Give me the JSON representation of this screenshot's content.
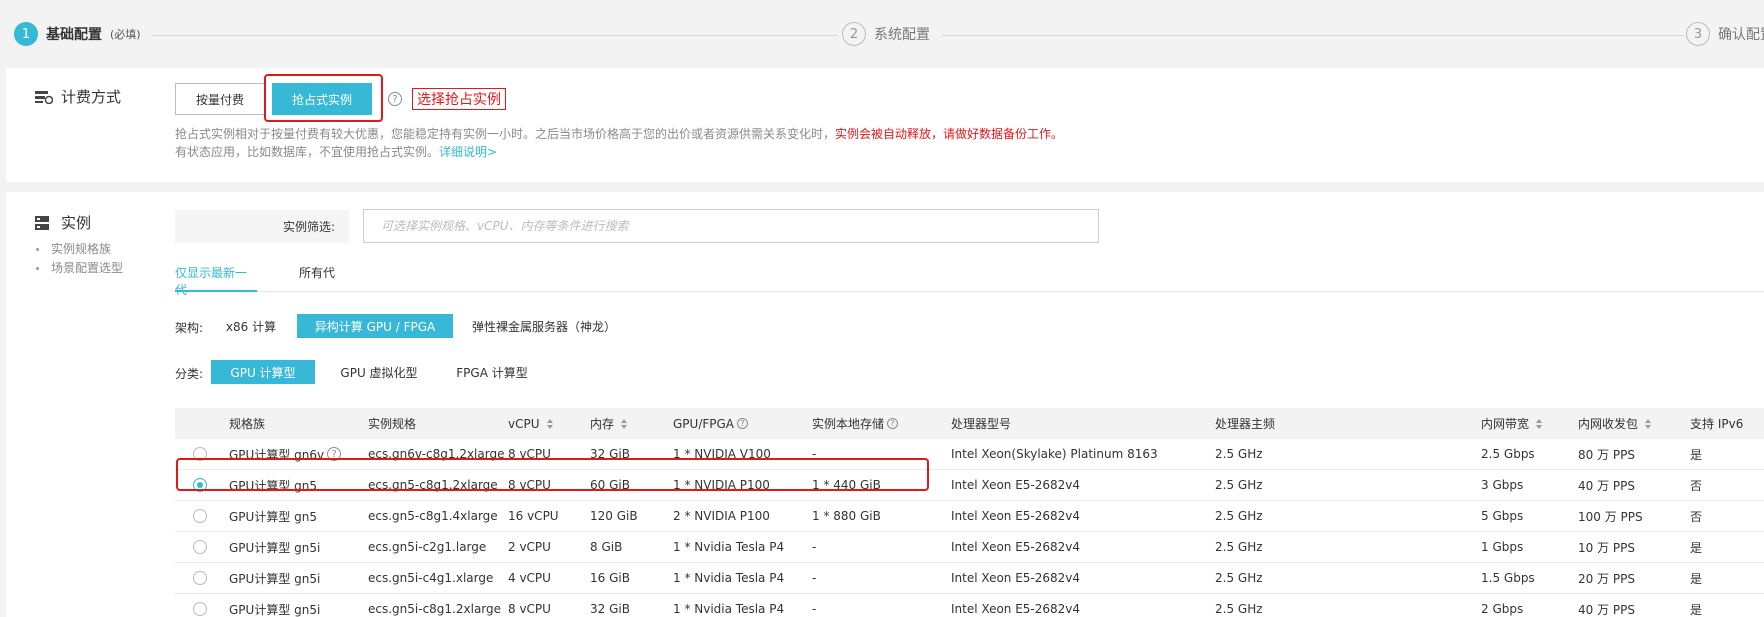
{
  "steps": [
    {
      "num": "1",
      "label": "基础配置",
      "sub": "(必填)"
    },
    {
      "num": "2",
      "label": "系统配置"
    },
    {
      "num": "3",
      "label": "确认配置"
    }
  ],
  "billing": {
    "title": "计费方式",
    "pay_as_you_go": "按量付费",
    "spot": "抢占式实例",
    "help": "?",
    "annotation": "选择抢占实例",
    "desc_line1": "抢占式实例相对于按量付费有较大优惠，您能稳定持有实例一小时。之后当市场价格高于您的出价或者资源供需关系变化时，",
    "desc_warn": "实例会被自动释放，请做好数据备份工作。",
    "desc_line2": "有状态应用，比如数据库，不宜使用抢占式实例。",
    "desc_link": "详细说明>"
  },
  "instance": {
    "title": "实例",
    "side_links": [
      "实例规格族",
      "场景配置选型"
    ],
    "filter_label": "实例筛选:",
    "filter_placeholder": "可选择实例规格、vCPU、内存等条件进行搜索",
    "tabs": [
      "仅显示最新一代",
      "所有代"
    ],
    "arch_label": "架构:",
    "arch_options": [
      "x86 计算",
      "异构计算 GPU / FPGA",
      "弹性裸金属服务器（神龙）"
    ],
    "cat_label": "分类:",
    "cat_options": [
      "GPU 计算型",
      "GPU 虚拟化型",
      "FPGA 计算型"
    ]
  },
  "table": {
    "headers": [
      "规格族",
      "实例规格",
      "vCPU",
      "内存",
      "GPU/FPGA",
      "实例本地存储",
      "处理器型号",
      "处理器主频",
      "内网带宽",
      "内网收发包",
      "支持 IPv6"
    ],
    "rows": [
      {
        "family": "GPU计算型 gn6v",
        "spec": "ecs.gn6v-c8g1.2xlarge",
        "vcpu": "8 vCPU",
        "mem": "32 GiB",
        "gpu": "1 * NVIDIA V100",
        "storage": "-",
        "cpu": "Intel Xeon(Skylake) Platinum 8163",
        "freq": "2.5 GHz",
        "bw": "2.5 Gbps",
        "pps": "80 万 PPS",
        "ipv6": "是"
      },
      {
        "family": "GPU计算型 gn5",
        "spec": "ecs.gn5-c8g1.2xlarge",
        "vcpu": "8 vCPU",
        "mem": "60 GiB",
        "gpu": "1 * NVIDIA P100",
        "storage": "1 * 440 GiB",
        "cpu": "Intel Xeon E5-2682v4",
        "freq": "2.5 GHz",
        "bw": "3 Gbps",
        "pps": "40 万 PPS",
        "ipv6": "否"
      },
      {
        "family": "GPU计算型 gn5",
        "spec": "ecs.gn5-c8g1.4xlarge",
        "vcpu": "16 vCPU",
        "mem": "120 GiB",
        "gpu": "2 * NVIDIA P100",
        "storage": "1 * 880 GiB",
        "cpu": "Intel Xeon E5-2682v4",
        "freq": "2.5 GHz",
        "bw": "5 Gbps",
        "pps": "100 万 PPS",
        "ipv6": "否"
      },
      {
        "family": "GPU计算型 gn5i",
        "spec": "ecs.gn5i-c2g1.large",
        "vcpu": "2 vCPU",
        "mem": "8 GiB",
        "gpu": "1 * Nvidia Tesla P4",
        "storage": "-",
        "cpu": "Intel Xeon E5-2682v4",
        "freq": "2.5 GHz",
        "bw": "1 Gbps",
        "pps": "10 万 PPS",
        "ipv6": "是"
      },
      {
        "family": "GPU计算型 gn5i",
        "spec": "ecs.gn5i-c4g1.xlarge",
        "vcpu": "4 vCPU",
        "mem": "16 GiB",
        "gpu": "1 * Nvidia Tesla P4",
        "storage": "-",
        "cpu": "Intel Xeon E5-2682v4",
        "freq": "2.5 GHz",
        "bw": "1.5 Gbps",
        "pps": "20 万 PPS",
        "ipv6": "是"
      },
      {
        "family": "GPU计算型 gn5i",
        "spec": "ecs.gn5i-c8g1.2xlarge",
        "vcpu": "8 vCPU",
        "mem": "32 GiB",
        "gpu": "1 * Nvidia Tesla P4",
        "storage": "-",
        "cpu": "Intel Xeon E5-2682v4",
        "freq": "2.5 GHz",
        "bw": "2 Gbps",
        "pps": "40 万 PPS",
        "ipv6": "是"
      }
    ]
  },
  "colors": {
    "accent": "#36b8d6",
    "annotation": "#e0191c"
  }
}
